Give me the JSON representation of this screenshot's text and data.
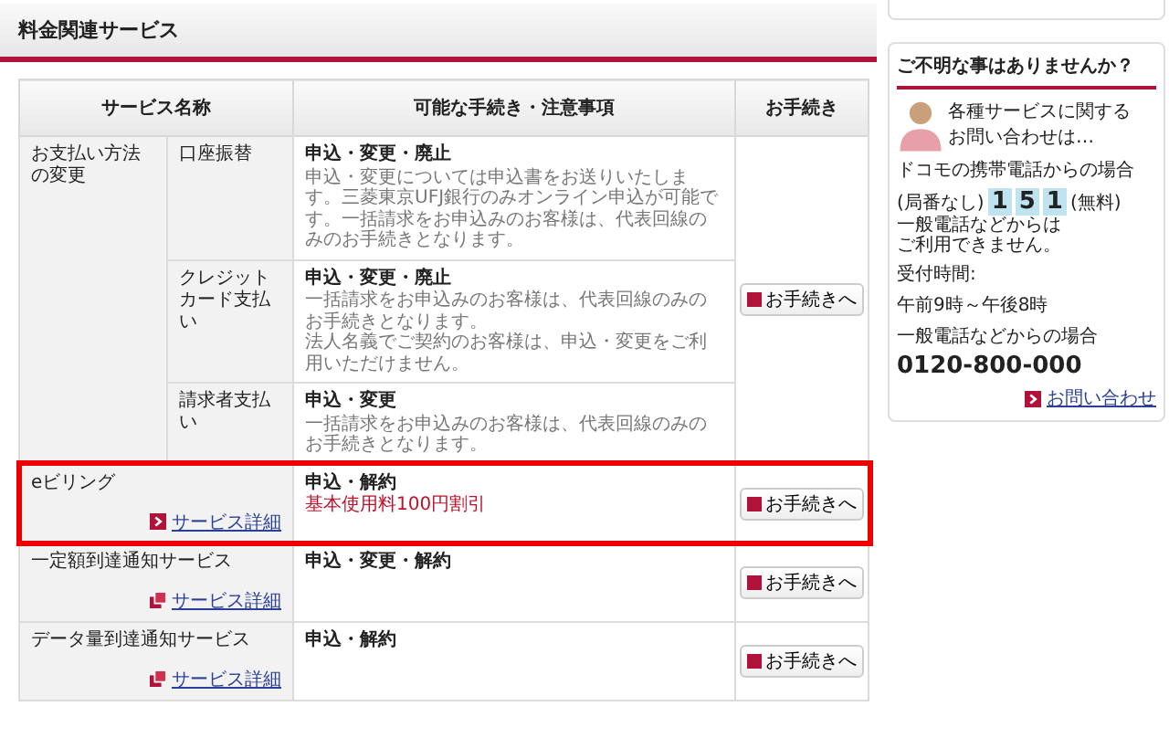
{
  "section_title": "料金関連サービス",
  "table": {
    "columns": [
      "サービス名称",
      "可能な手続き・注意事項",
      "お手続き"
    ],
    "rows": [
      {
        "kind": "group",
        "name": "お支払い方法の変更",
        "highlighted": false,
        "button": "お手続きへ",
        "subrows": [
          {
            "name": "口座振替",
            "procedures": "申込・変更・廃止",
            "notes": [
              "申込・変更については申込書をお送りいたします。三菱東京UFJ銀行のみオンライン申込が可能です。一括請求をお申込みのお客様は、代表回線のみのお手続きとなります。"
            ]
          },
          {
            "name": "クレジットカード支払い",
            "procedures": "申込・変更・廃止",
            "notes": [
              "一括請求をお申込みのお客様は、代表回線のみのお手続きとなります。",
              "法人名義でご契約のお客様は、申込・変更をご利用いただけません。"
            ]
          },
          {
            "name": "請求者支払い",
            "procedures": "申込・変更",
            "notes": [
              "一括請求をお申込みのお客様は、代表回線のみのお手続きとなります。"
            ]
          }
        ]
      },
      {
        "kind": "single",
        "name": "eビリング",
        "highlighted": true,
        "link": {
          "text": "サービス詳細",
          "kind": "arrow"
        },
        "procedures": "申込・解約",
        "note": {
          "text": "基本使用料100円割引",
          "kind": "promo"
        },
        "button": "お手続きへ"
      },
      {
        "kind": "single",
        "name": "一定額到達通知サービス",
        "highlighted": false,
        "link": {
          "text": "サービス詳細",
          "kind": "window"
        },
        "procedures": "申込・変更・解約",
        "button": "お手続きへ"
      },
      {
        "kind": "single",
        "name": "データ量到達通知サービス",
        "highlighted": false,
        "link": {
          "text": "サービス詳細",
          "kind": "window"
        },
        "procedures": "申込・解約",
        "button": "お手続きへ"
      }
    ]
  },
  "sidebar": {
    "title": "ご不明な事はありませんか？",
    "intro_lines": [
      "各種サービスに関する",
      "お問い合わせは…"
    ],
    "mobile_label": "ドコモの携帯電話からの場合",
    "prefix": "(局番なし)",
    "digits": [
      "1",
      "5",
      "1"
    ],
    "free": "(無料)",
    "mobile_note_lines": [
      "一般電話などからは",
      "ご利用できません。"
    ],
    "hours_label": "受付時間:",
    "hours": "午前9時～午後8時",
    "landline_label": "一般電話などからの場合",
    "landline_number": "0120-800-000",
    "link": "お問い合わせ"
  }
}
